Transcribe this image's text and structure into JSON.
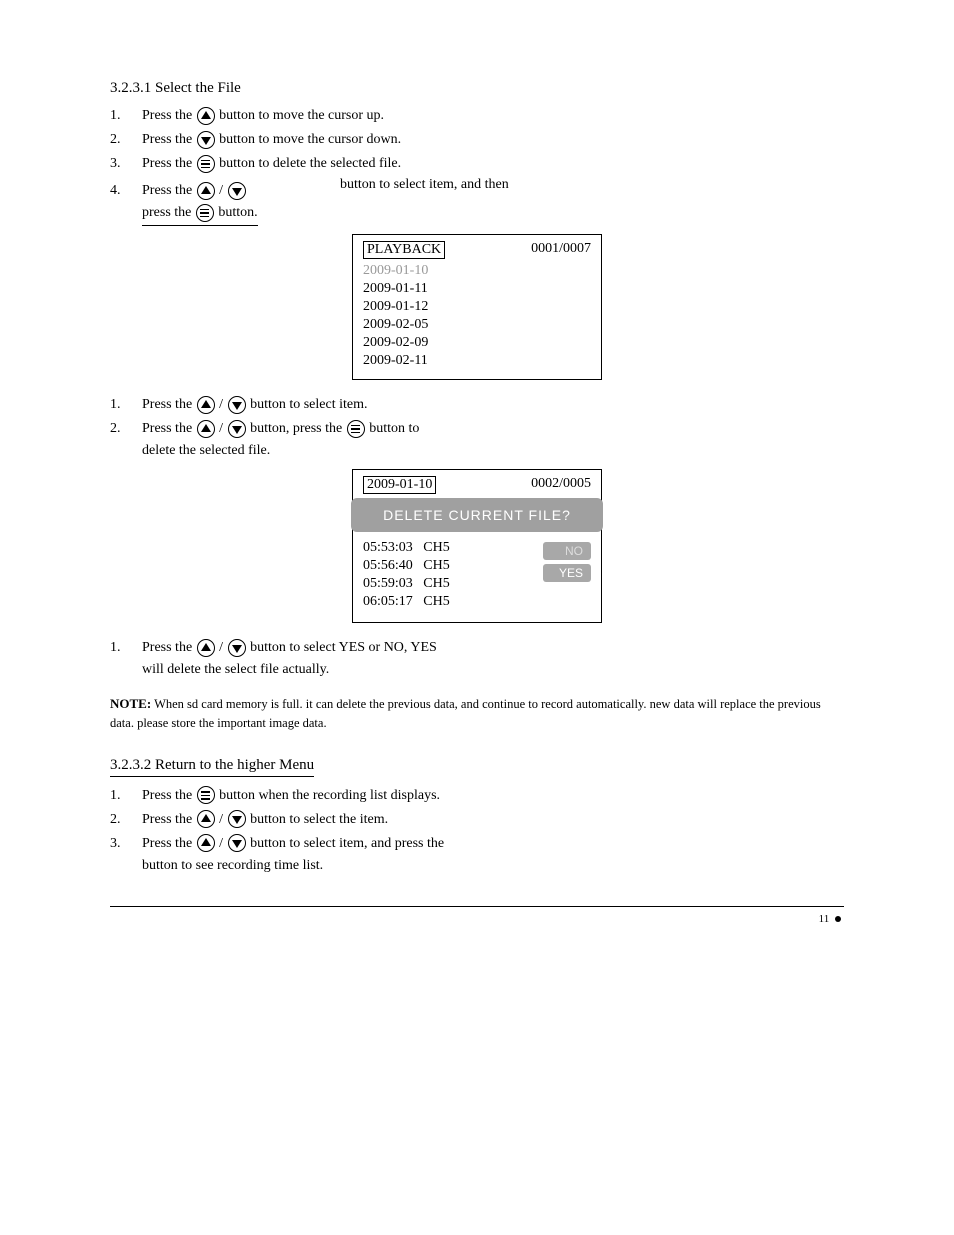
{
  "sectionA": {
    "title": "3.2.3.1 Select the File",
    "step1_pre": "Press the ",
    "step1_post": " button to move the cursor up.",
    "step2_pre": "Press the ",
    "step2_post": " button to move the cursor down.",
    "step3_pre": "Press the ",
    "step3_post": " button to delete the selected file.",
    "step4_pre": "Press the ",
    "step4_mid": "/",
    "step4_mid2": " button to select item, and then",
    "step4_line2_pre": "press the ",
    "step4_line2_post": " button."
  },
  "playback": {
    "title": "PLAYBACK",
    "counter": "0001/0007",
    "items": [
      "2009-01-10",
      "2009-01-11",
      "2009-01-12",
      "2009-02-05",
      "2009-02-09",
      "2009-02-11"
    ]
  },
  "sectionB": {
    "step1_pre": "Press the ",
    "step1_mid": "/",
    "step1_post": " button to select item.",
    "step2_pre": "Press the ",
    "step2_mid": "/",
    "step2_mid2": " button, press the ",
    "step2_post": " button to",
    "step2_line2": "delete the selected file."
  },
  "deleteDialog": {
    "date": "2009-01-10",
    "counter": "0002/0005",
    "prompt": "DELETE  CURRENT  FILE?",
    "rows": [
      {
        "time": "05:53:03",
        "ch": "CH5"
      },
      {
        "time": "05:56:40",
        "ch": "CH5"
      },
      {
        "time": "05:59:03",
        "ch": "CH5"
      },
      {
        "time": "06:05:17",
        "ch": "CH5"
      }
    ],
    "no": "NO",
    "yes": "YES"
  },
  "sectionC": {
    "step1_pre": "Press the ",
    "step1_mid": "/",
    "step1_post": " button to select YES or NO, YES",
    "step1_line2": "will delete the select file actually."
  },
  "note": {
    "title": "NOTE:",
    "body": "When sd card memory is full. it can delete the previous data, and continue to record automatically. new data will replace the previous data. please store the important image data."
  },
  "sectionD": {
    "title": "3.2.3.2 Return to the higher Menu",
    "step1_pre": "Press the ",
    "step1_post": " button when the recording list displays.",
    "step2_pre": "Press the ",
    "step2_mid": "/",
    "step2_post": " button to select the item.",
    "step3_pre": "Press the ",
    "step3_mid": "/",
    "step3_mid2": " button to select item, and press the ",
    "step3_line2": "button to see recording time list."
  },
  "footer": {
    "text": "11"
  }
}
